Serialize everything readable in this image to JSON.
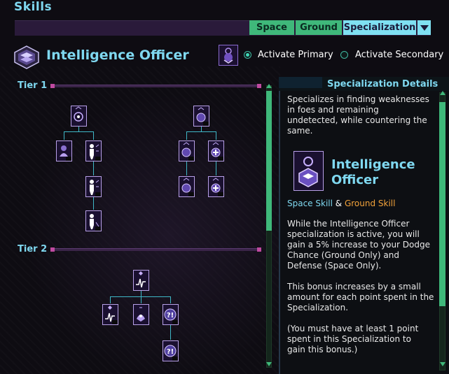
{
  "window": {
    "title": "Skills"
  },
  "tabs": [
    {
      "label": "Space",
      "selected": false
    },
    {
      "label": "Ground",
      "selected": false
    },
    {
      "label": "Specialization",
      "selected": true
    }
  ],
  "header": {
    "spec_name": "Intelligence Officer",
    "primary_label": "Activate Primary",
    "secondary_label": "Activate Secondary",
    "primary_selected": true
  },
  "tree": {
    "tier1_label": "Tier 1",
    "tier2_label": "Tier 2"
  },
  "details": {
    "heading": "Specialization Details",
    "summary": "Specializes in finding weaknesses in foes and remaining undetected, while countering the same.",
    "title_line1": "Intelligence",
    "title_line2": "Officer",
    "space_skill": "Space Skill",
    "amp": " & ",
    "ground_skill": "Ground Skill",
    "paragraph1": "While the Intelligence Officer specialization is active, you will gain a 5% increase to your Dodge Chance (Ground Only) and Defense (Space Only).",
    "paragraph2": "This bonus increases by a small amount for each point spent in the Specialization.",
    "paragraph3": "(You must have at least 1 point spent in this Specialization to gain this bonus.)"
  },
  "colors": {
    "accent": "#7fd8f0",
    "tab_green": "#3fb87a",
    "ground_orange": "#f2a23a",
    "node_border": "#b8a0e8"
  }
}
